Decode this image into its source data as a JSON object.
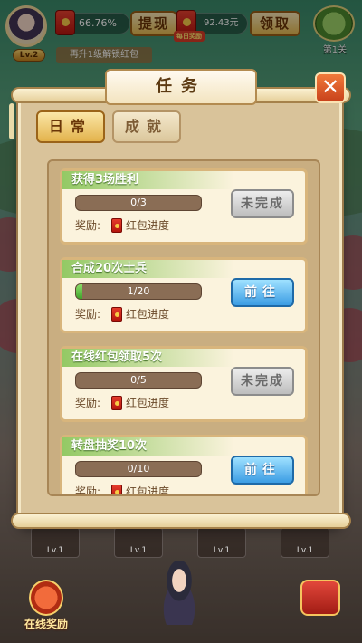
{
  "hud": {
    "level": "Lv.2",
    "redpack_percent": "66.76%",
    "withdraw_label": "提现",
    "daily_tag": "每日奖励",
    "money": "92.43元",
    "claim_label": "领取",
    "stage_label": "第1关",
    "upgrade_tip": "再升1级解锁红包"
  },
  "modal": {
    "title": "任务",
    "close_symbol": "✕",
    "tabs": [
      {
        "label": "日常",
        "active": true
      },
      {
        "label": "成就",
        "active": false
      }
    ],
    "reward_prefix": "奖励:",
    "tasks": [
      {
        "title": "获得3场胜利",
        "progress_text": "0/3",
        "progress": 0.0,
        "reward": "红包进度",
        "button": "未完成",
        "button_state": "incomplete"
      },
      {
        "title": "合成20次士兵",
        "progress_text": "1/20",
        "progress": 0.05,
        "reward": "红包进度",
        "button": "前往",
        "button_state": "go"
      },
      {
        "title": "在线红包领取5次",
        "progress_text": "0/5",
        "progress": 0.0,
        "reward": "红包进度",
        "button": "未完成",
        "button_state": "incomplete"
      },
      {
        "title": "转盘抽奖10次",
        "progress_text": "0/10",
        "progress": 0.0,
        "reward": "红包进度",
        "button": "前往",
        "button_state": "go"
      }
    ]
  },
  "bottom": {
    "unit_levels": [
      "Lv.1",
      "Lv.1",
      "Lv.1",
      "Lv.1"
    ],
    "online_reward_label": "在线奖励"
  },
  "colors": {
    "go_button": "#3c9de4",
    "incomplete_button": "#bdbdbd",
    "task_title_green": "#93c964",
    "modal_bg": "#d9c39a"
  }
}
